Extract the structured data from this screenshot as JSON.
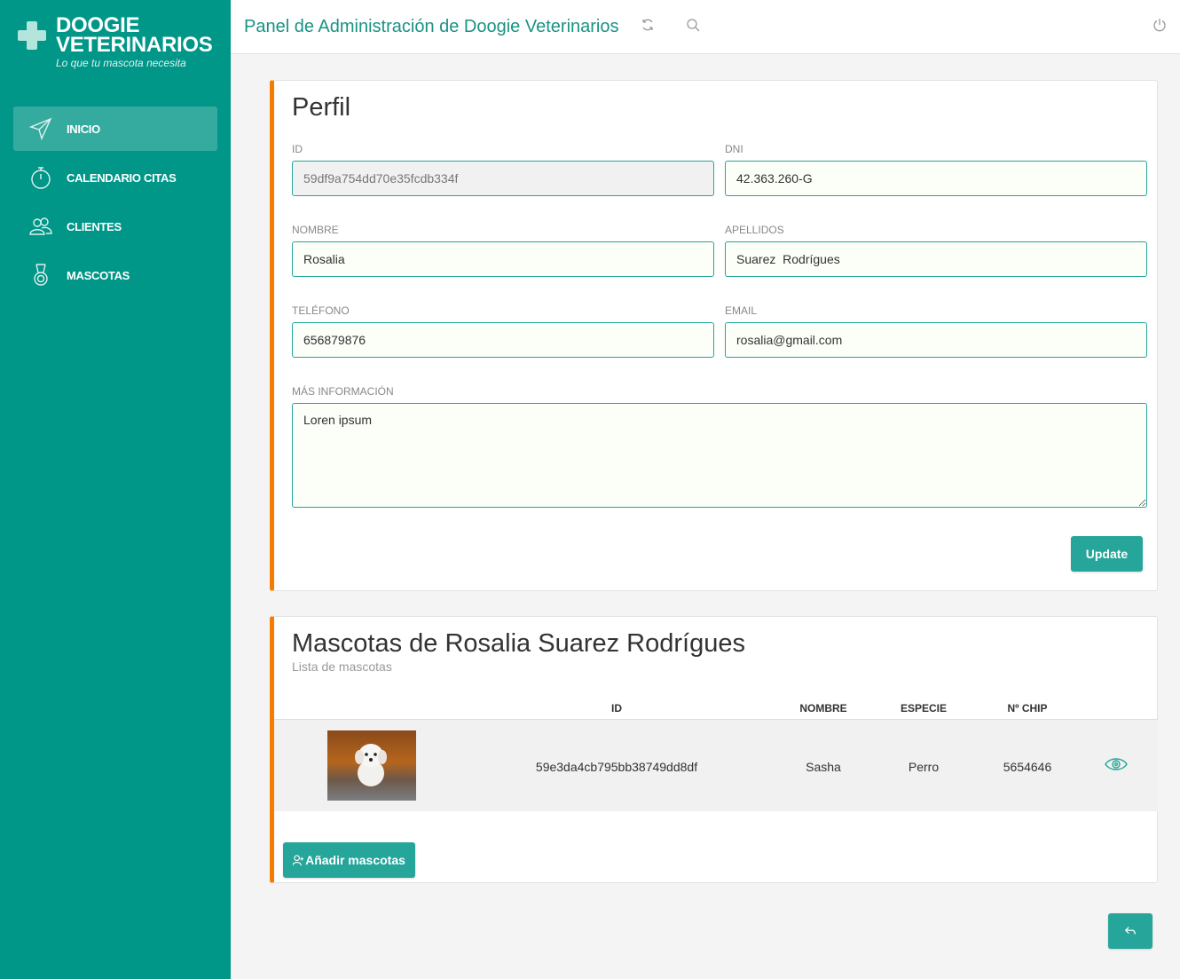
{
  "brand": {
    "name_line1": "DOOGIE",
    "name_line2": "VETERINARIOS",
    "tagline": "Lo que tu mascota necesita"
  },
  "sidebar": {
    "items": [
      {
        "label": "INICIO",
        "icon": "paper-plane-icon",
        "active": true
      },
      {
        "label": "CALENDARIO CITAS",
        "icon": "stopwatch-icon",
        "active": false
      },
      {
        "label": "CLIENTES",
        "icon": "users-icon",
        "active": false
      },
      {
        "label": "MASCOTAS",
        "icon": "medal-icon",
        "active": false
      }
    ]
  },
  "header": {
    "title": "Panel de Administración de Doogie Veterinarios",
    "icons": [
      "refresh-icon",
      "search-icon",
      "power-icon"
    ]
  },
  "profile": {
    "title": "Perfil",
    "fields": {
      "id": {
        "label": "ID",
        "value": "59df9a754dd70e35fcdb334f"
      },
      "dni": {
        "label": "DNI",
        "value": "42.363.260-G"
      },
      "nombre": {
        "label": "NOMBRE",
        "value": "Rosalia"
      },
      "apellidos": {
        "label": "APELLIDOS",
        "value": "Suarez  Rodrígues"
      },
      "telefono": {
        "label": "TELÉFONO",
        "value": "656879876"
      },
      "email": {
        "label": "EMAIL",
        "value": "rosalia@gmail.com"
      },
      "info": {
        "label": "MÁS INFORMACIÓN",
        "value": "Loren ipsum"
      }
    },
    "update_label": "Update"
  },
  "pets": {
    "title": "Mascotas de Rosalia Suarez Rodrígues",
    "subtitle": "Lista de mascotas",
    "columns": [
      "ID",
      "NOMBRE",
      "ESPECIE",
      "Nº CHIP"
    ],
    "rows": [
      {
        "id": "59e3da4cb795bb38749dd8df",
        "nombre": "Sasha",
        "especie": "Perro",
        "chip": "5654646"
      }
    ],
    "add_label": "Añadir mascotas"
  },
  "colors": {
    "sidebar": "#009688",
    "accent": "#26a69a",
    "card_border": "#f57c00",
    "header_title": "#1a9384"
  }
}
